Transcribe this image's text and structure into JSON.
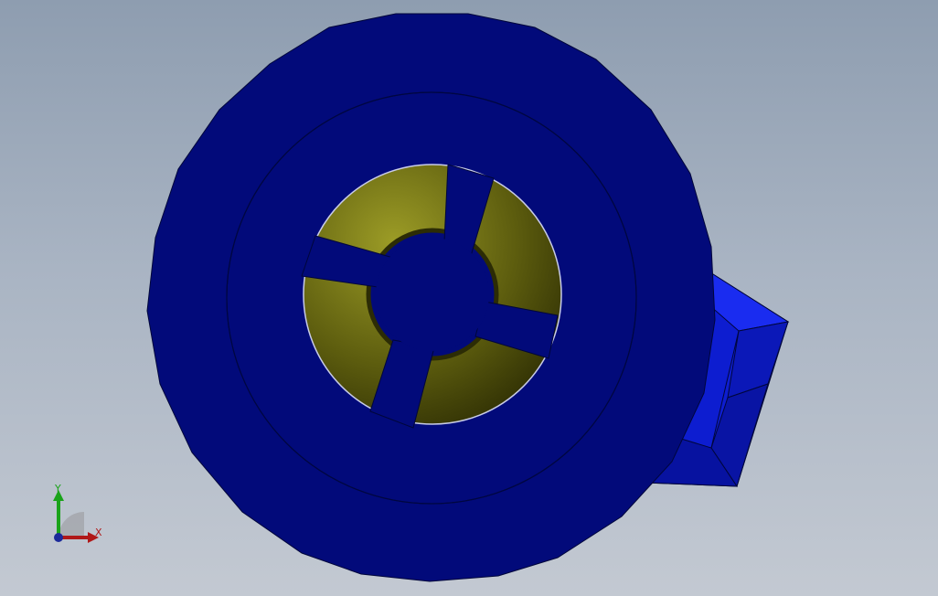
{
  "viewport": {
    "background_top": "#8e9db0",
    "background_bottom": "#c3c9d2"
  },
  "model": {
    "body_color": "#020a7a",
    "edge_color": "#00063a",
    "insert_color": "#6b6b10",
    "bracket_color": "#0a18c8"
  },
  "triad": {
    "y_label": "Y",
    "x_label": "X",
    "y_color": "#1aa31a",
    "x_color": "#b01818",
    "origin_color": "#1b2a9a"
  }
}
